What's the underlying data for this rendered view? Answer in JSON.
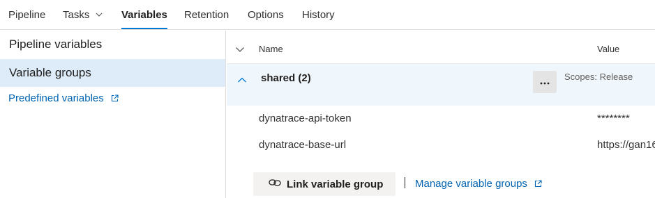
{
  "tabs": [
    {
      "label": "Pipeline"
    },
    {
      "label": "Tasks"
    },
    {
      "label": "Variables"
    },
    {
      "label": "Retention"
    },
    {
      "label": "Options"
    },
    {
      "label": "History"
    }
  ],
  "active_tab": "Variables",
  "left_nav": {
    "pipeline_variables": "Pipeline variables",
    "variable_groups": "Variable groups",
    "predefined_variables": "Predefined variables"
  },
  "table": {
    "header_name": "Name",
    "header_value": "Value"
  },
  "group": {
    "name": "shared (2)",
    "scopes": "Scopes: Release",
    "more_glyph": "···"
  },
  "variables": [
    {
      "name": "dynatrace-api-token",
      "value": "********"
    },
    {
      "name": "dynatrace-base-url",
      "value": "https://gan16"
    }
  ],
  "actions": {
    "link_variable_group": "Link variable group",
    "divider": "|",
    "manage_variable_groups": "Manage variable groups"
  },
  "colors": {
    "accent": "#0078d4",
    "link": "#0063b1",
    "selected_bg": "#deecf9",
    "group_bg": "#eff6fc"
  },
  "icons": {
    "external_link": "external-link-icon",
    "chevron_down": "chevron-down-icon",
    "chevron_up": "chevron-up-icon",
    "link": "link-icon",
    "more": "more-icon"
  }
}
